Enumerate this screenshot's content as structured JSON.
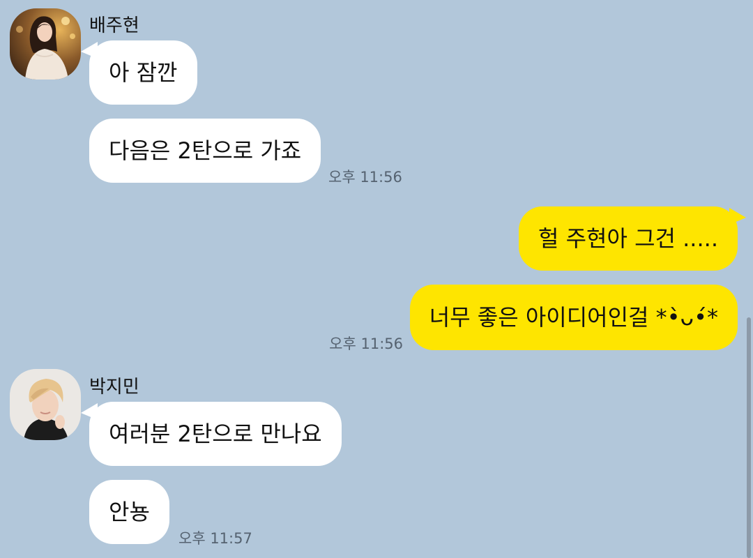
{
  "colors": {
    "background": "#b2c7da",
    "incoming_bubble": "#ffffff",
    "outgoing_bubble": "#fee500",
    "timestamp_text": "#556270"
  },
  "conversation": [
    {
      "sender": "배주현",
      "avatar_icon": "profile-photo",
      "messages": [
        "아 잠깐",
        "다음은 2탄으로 가죠"
      ],
      "time": "오후 11:56"
    },
    {
      "sender": "me",
      "messages": [
        "헐 주현아 그건 .....",
        "너무 좋은 아이디어인걸 *•̀ᴗ•́*"
      ],
      "time": "오후 11:56"
    },
    {
      "sender": "박지민",
      "avatar_icon": "profile-photo",
      "messages": [
        "여러분 2탄으로 만나요",
        "안뇽"
      ],
      "time": "오후 11:57"
    }
  ]
}
